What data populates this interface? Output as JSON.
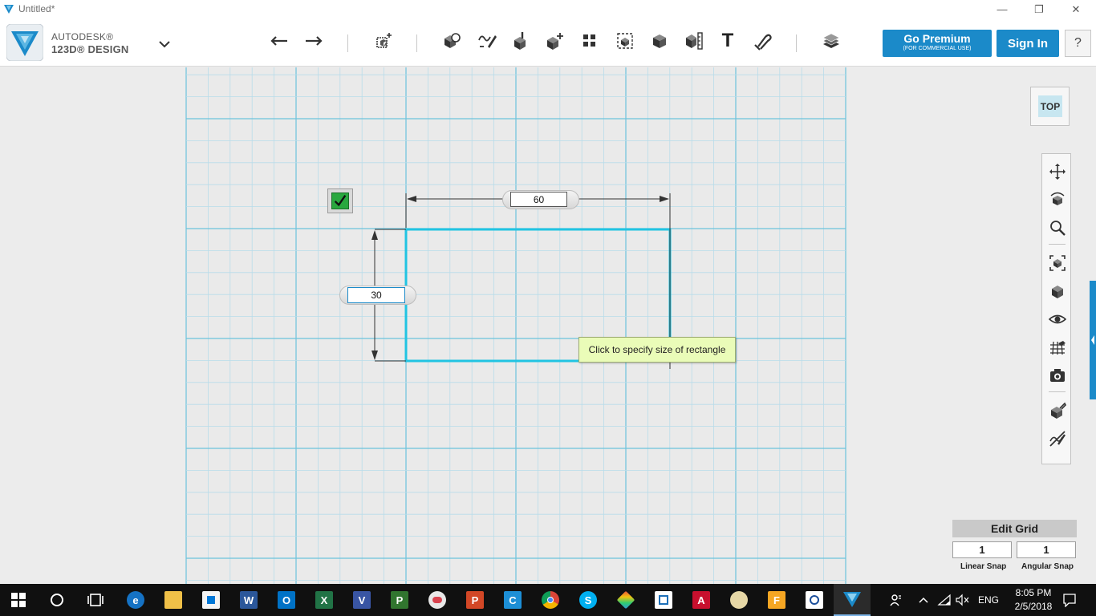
{
  "window": {
    "title": "Untitled*",
    "minimize_glyph": "—",
    "restore_glyph": "❐",
    "close_glyph": "✕"
  },
  "brand": {
    "line1": "AUTODESK®",
    "line2": "123D® DESIGN"
  },
  "toolbar": {
    "undo_glyph": "↶",
    "redo_glyph": "↷",
    "text_tool_glyph": "T",
    "tools": [
      "undo-icon",
      "redo-icon",
      "transform-icon",
      "primitives-icon",
      "sketch-icon",
      "construct-icon",
      "modify-icon",
      "pattern-icon",
      "grouping-icon",
      "combine-icon",
      "measure-icon",
      "text-icon",
      "snap-icon",
      "materials-icon"
    ],
    "premium_label": "Go Premium",
    "premium_sub": "(FOR COMMERCIAL USE)",
    "signin_label": "Sign In",
    "help_label": "?"
  },
  "sketch": {
    "width_value": "60",
    "height_value": "30",
    "tooltip": "Click to specify size of rectangle"
  },
  "viewcube": {
    "face_label": "TOP"
  },
  "navbar": {
    "items": [
      "pan-icon",
      "orbit-icon",
      "zoom-icon",
      "fit-icon",
      "view-mode-icon",
      "visibility-icon",
      "grid-icon",
      "screenshot-icon",
      "materials-outline-icon",
      "hide-sketch-icon"
    ]
  },
  "edit_grid": {
    "title": "Edit Grid",
    "linear_snap_value": "1",
    "angular_snap_value": "1",
    "linear_snap_label": "Linear Snap",
    "angular_snap_label": "Angular Snap"
  },
  "taskbar": {
    "apps": [
      "start",
      "cortana",
      "task-view",
      "edge",
      "file-explorer",
      "store",
      "word",
      "outlook",
      "excel",
      "visio",
      "project",
      "paint-3d",
      "powerpoint",
      "ccleaner",
      "chrome",
      "skype",
      "app-diamond",
      "app-frame",
      "autocad",
      "paint",
      "fusion",
      "app-camera",
      "123d-design"
    ],
    "language": "ENG",
    "time": "8:05 PM",
    "date": "2/5/2018"
  },
  "colors": {
    "grid_minor": "#b8dcea",
    "grid_major": "#6cc3dc",
    "sketch_line": "#21c4e2",
    "accent": "#1b8ac9",
    "tooltip_bg": "#eafcb8"
  }
}
